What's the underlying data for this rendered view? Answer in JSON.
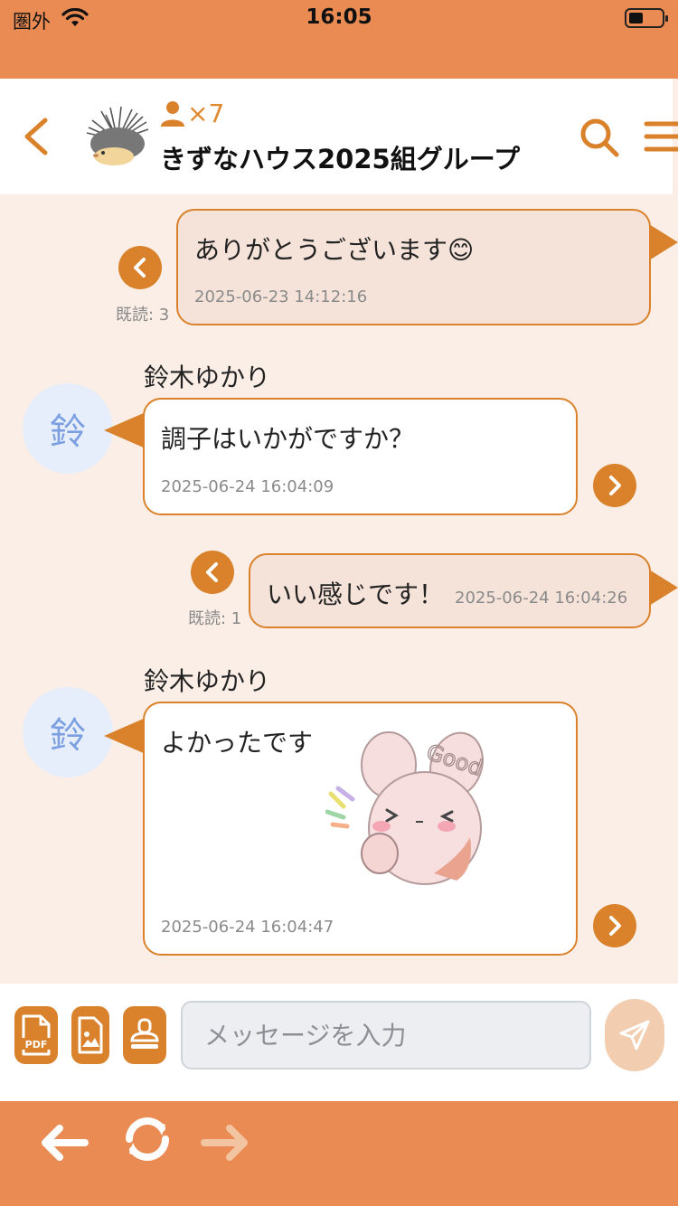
{
  "status_bar": {
    "carrier": "圏外",
    "time": "16:05"
  },
  "header": {
    "member_count": "×7",
    "title": "きずなハウス2025組グループ"
  },
  "messages": [
    {
      "kind": "mine",
      "text": "ありがとうございます",
      "emoji": "😊",
      "time": "2025-06-23 14:12:16",
      "read": "既読: 3"
    },
    {
      "kind": "theirs",
      "sender": "鈴木ゆかり",
      "avatar_char": "鈴",
      "text": "調子はいかがですか？",
      "time": "2025-06-24 16:04:09"
    },
    {
      "kind": "mine",
      "text": "いい感じです！",
      "time": "2025-06-24 16:04:26",
      "read": "既読: 1"
    },
    {
      "kind": "theirs",
      "sender": "鈴木ゆかり",
      "avatar_char": "鈴",
      "text": "よかったです",
      "sticker_text": "Good",
      "time": "2025-06-24 16:04:47"
    }
  ],
  "composer": {
    "placeholder": "メッセージを入力",
    "pdf_label": "PDF"
  },
  "colors": {
    "accent": "#d9822b",
    "bar": "#e98b52",
    "mine_bubble": "#f5e3da",
    "background": "#fbeee6"
  }
}
